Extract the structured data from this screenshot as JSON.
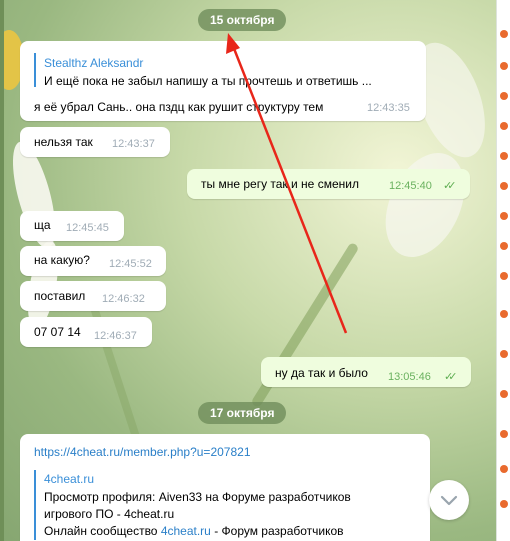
{
  "dates": {
    "first": "15 октября",
    "second": "17 октября"
  },
  "messages": [
    {
      "text": "я её убрал Сань.. она пздц как рушит структуру тем",
      "time": "12:43:35",
      "reply": {
        "name": "Stealthz Aleksandr",
        "text": "И ещё пока не забыл напишу а ты прочтешь и ответишь ..."
      }
    },
    {
      "text": "нельзя так",
      "time": "12:43:37"
    },
    {
      "text": "ты мне регу так и не сменил",
      "time": "12:45:40"
    },
    {
      "text": "ща",
      "time": "12:45:45"
    },
    {
      "text": "на какую?",
      "time": "12:45:52"
    },
    {
      "text": "поставил",
      "time": "12:46:32"
    },
    {
      "text": "07 07 14",
      "time": "12:46:37"
    },
    {
      "text": "ну да так и было",
      "time": "13:05:46"
    }
  ],
  "link_message": {
    "url": "https://4cheat.ru/member.php?u=207821",
    "preview_site": "4cheat.ru",
    "preview_title_1": "Просмотр профиля: Aiven33 на Форуме разработчиков",
    "preview_title_2": "игрового ПО - 4cheat.ru",
    "preview_desc_before": "Онлайн сообщество ",
    "preview_desc_link": "4cheat.ru",
    "preview_desc_after": " - Форум разработчиков"
  },
  "icons": {
    "checks": "double-check-icon",
    "scroll": "chevron-down-icon",
    "arrow": "annotation-arrow"
  },
  "colors": {
    "accent": "#3a8fd8",
    "outgoing": "#effdde",
    "arrow": "#e8261a"
  }
}
